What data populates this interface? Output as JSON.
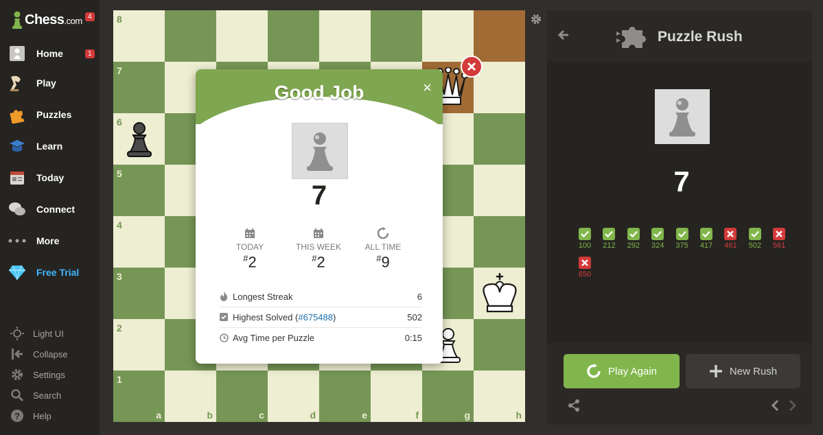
{
  "sidebar": {
    "logo_text": "Chess",
    "logo_suffix": ".com",
    "logo_badge": "4",
    "items": [
      {
        "label": "Home",
        "icon": "home-icon",
        "badge": "1"
      },
      {
        "label": "Play",
        "icon": "play-icon"
      },
      {
        "label": "Puzzles",
        "icon": "puzzles-icon"
      },
      {
        "label": "Learn",
        "icon": "learn-icon"
      },
      {
        "label": "Today",
        "icon": "today-icon"
      },
      {
        "label": "Connect",
        "icon": "connect-icon"
      },
      {
        "label": "More",
        "icon": "more-icon"
      },
      {
        "label": "Free Trial",
        "icon": "diamond-icon"
      }
    ],
    "utilities": [
      {
        "label": "Light UI",
        "icon": "sun-icon"
      },
      {
        "label": "Collapse",
        "icon": "collapse-icon"
      },
      {
        "label": "Settings",
        "icon": "gear-icon"
      },
      {
        "label": "Search",
        "icon": "search-icon"
      },
      {
        "label": "Help",
        "icon": "help-icon"
      }
    ]
  },
  "board": {
    "ranks": [
      "8",
      "7",
      "6",
      "5",
      "4",
      "3",
      "2",
      "1"
    ],
    "files": [
      "a",
      "b",
      "c",
      "d",
      "e",
      "f",
      "g",
      "h"
    ],
    "colors": {
      "light": "#eeeed2",
      "dark": "#769656",
      "highlight": "#a16b36"
    }
  },
  "modal": {
    "title": "Good Job",
    "close": "×",
    "score": "7",
    "stats": [
      {
        "label": "TODAY",
        "rank": "2"
      },
      {
        "label": "THIS WEEK",
        "rank": "2"
      },
      {
        "label": "ALL TIME",
        "rank": "9"
      }
    ],
    "hash": "#",
    "rows": {
      "streak_label": "Longest Streak",
      "streak_value": "6",
      "highest_label": "Highest Solved (",
      "highest_link": "#675488",
      "highest_close": ")",
      "highest_value": "502",
      "avg_label": "Avg Time per Puzzle",
      "avg_value": "0:15"
    }
  },
  "panel": {
    "title": "Puzzle Rush",
    "score": "7",
    "results": [
      {
        "rating": "100",
        "ok": true
      },
      {
        "rating": "212",
        "ok": true
      },
      {
        "rating": "292",
        "ok": true
      },
      {
        "rating": "324",
        "ok": true
      },
      {
        "rating": "375",
        "ok": true
      },
      {
        "rating": "417",
        "ok": true
      },
      {
        "rating": "461",
        "ok": false
      },
      {
        "rating": "502",
        "ok": true
      },
      {
        "rating": "561",
        "ok": false
      },
      {
        "rating": "650",
        "ok": false
      }
    ],
    "play_again": "Play Again",
    "new_rush": "New Rush",
    "accent": "#81b64c",
    "fail": "#d33a3a"
  }
}
